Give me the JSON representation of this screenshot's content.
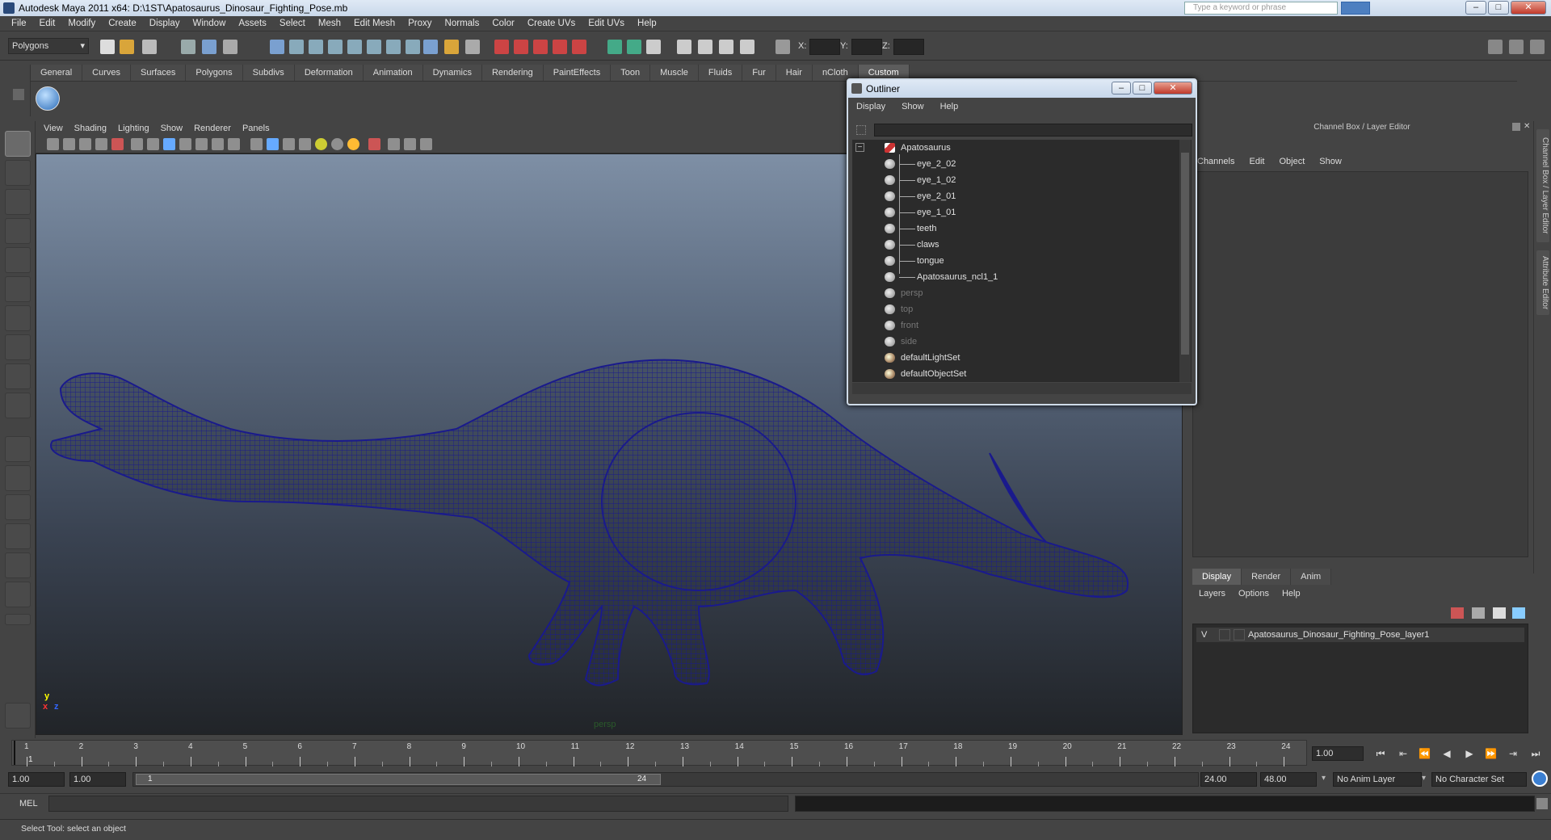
{
  "window": {
    "title": "Autodesk Maya 2011 x64: D:\\1ST\\Apatosaurus_Dinosaur_Fighting_Pose.mb",
    "search_placeholder": "Type a keyword or phrase",
    "min": "–",
    "max": "□",
    "close": "✕"
  },
  "menubar": [
    "File",
    "Edit",
    "Modify",
    "Create",
    "Display",
    "Window",
    "Assets",
    "Select",
    "Mesh",
    "Edit Mesh",
    "Proxy",
    "Normals",
    "Color",
    "Create UVs",
    "Edit UVs",
    "Help"
  ],
  "statusline": {
    "mode_dropdown": "Polygons",
    "x_label": "X:",
    "y_label": "Y:",
    "z_label": "Z:"
  },
  "shelf": {
    "tabs": [
      "General",
      "Curves",
      "Surfaces",
      "Polygons",
      "Subdivs",
      "Deformation",
      "Animation",
      "Dynamics",
      "Rendering",
      "PaintEffects",
      "Toon",
      "Muscle",
      "Fluids",
      "Fur",
      "Hair",
      "nCloth",
      "Custom"
    ],
    "active_tab": "Custom"
  },
  "viewport": {
    "menu": [
      "View",
      "Shading",
      "Lighting",
      "Show",
      "Renderer",
      "Panels"
    ],
    "camera_label": "persp",
    "axis_y": "y",
    "axis_x": "x",
    "axis_z": "z",
    "wire_color": "#1a1a8c"
  },
  "outliner": {
    "title": "Outliner",
    "menu": [
      "Display",
      "Show",
      "Help"
    ],
    "root": "Apatosaurus",
    "children": [
      "eye_2_02",
      "eye_1_02",
      "eye_2_01",
      "eye_1_01",
      "teeth",
      "claws",
      "tongue",
      "Apatosaurus_ncl1_1"
    ],
    "cameras": [
      "persp",
      "top",
      "front",
      "side"
    ],
    "sets": [
      "defaultLightSet",
      "defaultObjectSet"
    ],
    "collapse": "−"
  },
  "channelbox": {
    "header": "Channel Box / Layer Editor",
    "menu": [
      "Channels",
      "Edit",
      "Object",
      "Show"
    ],
    "side_tabs": [
      "Channel Box / Layer Editor",
      "Attribute Editor"
    ]
  },
  "layereditor": {
    "tabs": [
      "Display",
      "Render",
      "Anim"
    ],
    "active_tab": "Display",
    "menu": [
      "Layers",
      "Options",
      "Help"
    ],
    "layer_visibility": "V",
    "layer_name": "Apatosaurus_Dinosaur_Fighting_Pose_layer1"
  },
  "timeslider": {
    "ticks": [
      "1",
      "2",
      "3",
      "4",
      "5",
      "6",
      "7",
      "8",
      "9",
      "10",
      "11",
      "12",
      "13",
      "14",
      "15",
      "16",
      "17",
      "18",
      "19",
      "20",
      "21",
      "22",
      "23",
      "24"
    ],
    "current_marker": "1",
    "current_frame": "1.00",
    "playback": [
      "⏮",
      "⇤",
      "⏪",
      "◀",
      "▶",
      "⏩",
      "⇥",
      "⏭"
    ]
  },
  "rangeslider": {
    "start_time": "1.00",
    "playback_start": "1.00",
    "range_start_label": "1",
    "range_end_label": "24",
    "playback_end": "24.00",
    "end_time": "48.00",
    "anim_layer": "No Anim Layer",
    "character_set": "No Character Set"
  },
  "commandline": {
    "label": "MEL"
  },
  "helpline": {
    "text": "Select Tool: select an object"
  }
}
